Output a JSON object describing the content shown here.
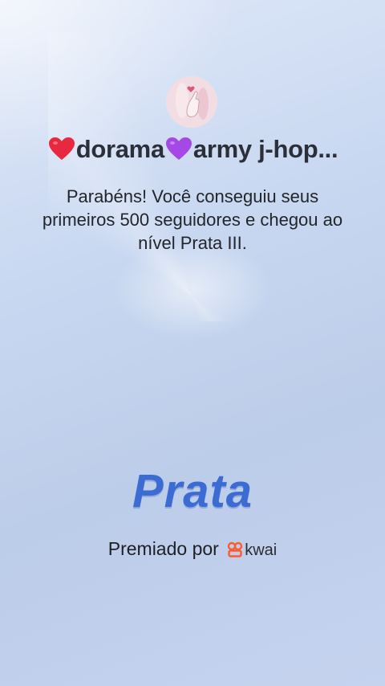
{
  "profile": {
    "avatar_icon": "finger-heart-icon",
    "name_part1": "dorama",
    "name_part2": "army j-hop...",
    "heart1_icon": "red-heart-icon",
    "heart2_icon": "purple-heart-icon"
  },
  "message": "Parabéns! Você conseguiu seus primeiros 500 seguidores e chegou ao nível Prata III.",
  "level_badge": "Prata",
  "awarded_by": {
    "label": "Premiado por",
    "brand": "kwai",
    "brand_icon": "kwai-logo-icon"
  },
  "colors": {
    "level": "#3d6bd4",
    "brand": "#ff5a2c",
    "red_heart": "#e8283f",
    "purple_heart": "#a548e6"
  }
}
